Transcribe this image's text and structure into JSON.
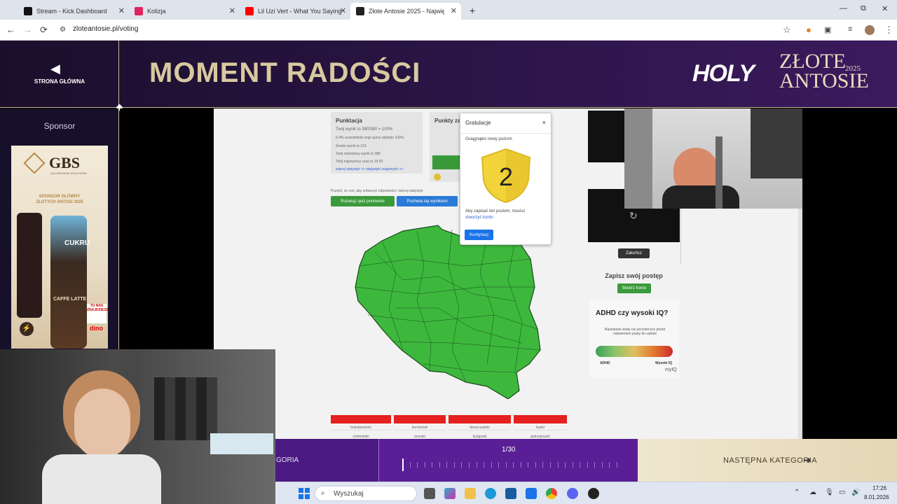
{
  "browser": {
    "tabs": [
      {
        "label": "Stream - Kick Dashboard",
        "favicon_color": "#111111"
      },
      {
        "label": "Kolizja",
        "favicon_color": "#e0245e"
      },
      {
        "label": "Lil Uzi Vert - What You Saying",
        "favicon_color": "#ff0000"
      },
      {
        "label": "Złote Antosie 2025 - Najwię",
        "favicon_color": "#222222"
      }
    ],
    "new_tab": "+",
    "url": "zloteantosie.pl/voting",
    "icons": {
      "back": "←",
      "forward": "→",
      "reload": "⟳",
      "star": "☆",
      "minimize": "—",
      "restore": "⧉",
      "close": "✕",
      "menu": "⋮"
    }
  },
  "site": {
    "home_label": "STRONA GŁÓWNA",
    "page_title": "MOMENT RADOŚCI",
    "brand_holy": "HOLY",
    "brand_zlote": "ZŁOTE",
    "brand_antosie": "ANTOSIE",
    "brand_year": "2025"
  },
  "sidebar": {
    "sponsor_label": "Sponsor",
    "ad": {
      "brand": "GBS",
      "brand_sub": "GOLDEN BOW SOLUTIONS",
      "tagline_line1": "SPONSOR GŁÓWNY",
      "tagline_line2": "ZŁOTYCH ANTOSI 2025",
      "can_text": "CUKRU",
      "latte": "CAFFE LATTE",
      "store_text": "TU NAS ZNAJDZIESZ",
      "store": "dino"
    }
  },
  "quiz": {
    "panel1_title": "Punktacja",
    "panel1_lines": [
      "Twój wynik to 380/380 = 100%",
      "6.4% uczestników tego quizu zdobyło 100%",
      "Średni wynik to 123",
      "Twój rekordowy wynik to 380",
      "Twój najszybszy czas to 19:59"
    ],
    "panel1_links": "więcej statystyk >>   statystyki znajomych >>",
    "panel2_title": "Punkty za",
    "share_text": "Pozwól, że coś, aby zobaczyć odpowiedzi i więcej statystyk",
    "retry_button": "Rozwiąż quiz ponownie",
    "share_button": "Pochwal się wynikiem",
    "table_headers": [
      "",
      "",
      "",
      ""
    ],
    "table_row1": [
      "bolesławiecki",
      "bocheński",
      "bieszczadzki",
      "buski"
    ],
    "table_row2": [
      "chełmiński",
      "brzeski",
      "bydgoski",
      "jędrzejowski"
    ]
  },
  "modal": {
    "title": "Gratulacje",
    "close": "×",
    "message": "Osiągnąłeś nowy poziom",
    "level": "2",
    "save_text": "Aby zapisać ten poziom, musisz",
    "save_link": "stworzyć konto",
    "continue_button": "Kontynuuj"
  },
  "right_column": {
    "save_progress": "Zapisz swój postęp",
    "create_account": "Stwórz konto",
    "close_ad": "Zakończ",
    "ad_title": "ADHD czy wysoki IQ?",
    "ad_text": "Naszdanie wody na szczoteczce przed nałożeniem pasty do zębów",
    "ad_left": "ADHD",
    "ad_right": "Wysoki IQ",
    "ad_brand": "myIQ"
  },
  "bottom_bar": {
    "prev_category": "GORIA",
    "progress_count": "1/30",
    "progress_fraction": 0.033,
    "next_category": "NASTĘPNA KATEGORIA",
    "next_arrow": "➜"
  },
  "taskbar": {
    "search_placeholder": "Wyszukaj",
    "time": "17:26",
    "date": "8.01.2026"
  }
}
